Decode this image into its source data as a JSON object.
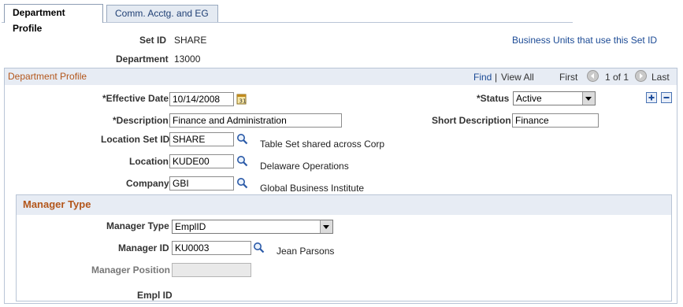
{
  "tabs": [
    {
      "label": "Department Profile",
      "active": true
    },
    {
      "label": "Comm. Acctg. and EG",
      "active": false
    }
  ],
  "header": {
    "setid_label": "Set ID",
    "setid_value": "SHARE",
    "department_label": "Department",
    "department_value": "13000",
    "bu_link": "Business Units that use this Set ID"
  },
  "group": {
    "title": "Department Profile",
    "find": "Find",
    "separator": "|",
    "view_all": "View All",
    "first": "First",
    "count": "1 of 1",
    "last": "Last"
  },
  "fields": {
    "effective_date_label": "*Effective Date",
    "effective_date_value": "10/14/2008",
    "status_label": "*Status",
    "status_value": "Active",
    "description_label": "*Description",
    "description_value": "Finance and Administration",
    "short_description_label": "Short Description",
    "short_description_value": "Finance",
    "location_setid_label": "Location Set ID",
    "location_setid_value": "SHARE",
    "location_setid_desc": "Table Set shared across Corp",
    "location_label": "Location",
    "location_value": "KUDE00",
    "location_desc": "Delaware Operations",
    "company_label": "Company",
    "company_value": "GBI",
    "company_desc": "Global Business Institute"
  },
  "manager": {
    "title": "Manager Type",
    "type_label": "Manager Type",
    "type_value": "EmplID",
    "id_label": "Manager ID",
    "id_value": "KU0003",
    "id_desc": "Jean Parsons",
    "position_label": "Manager Position",
    "position_value": "",
    "emplid_label": "Empl ID"
  },
  "icons": {
    "calendar": "calendar-icon",
    "lookup": "magnifier-icon",
    "prev": "previous-arrow-icon",
    "next": "next-arrow-icon",
    "add": "plus-icon",
    "delete": "minus-icon"
  },
  "colors": {
    "link": "#1b4a95",
    "section_title": "#b3561b",
    "section_header_bg": "#e7ecf4"
  }
}
